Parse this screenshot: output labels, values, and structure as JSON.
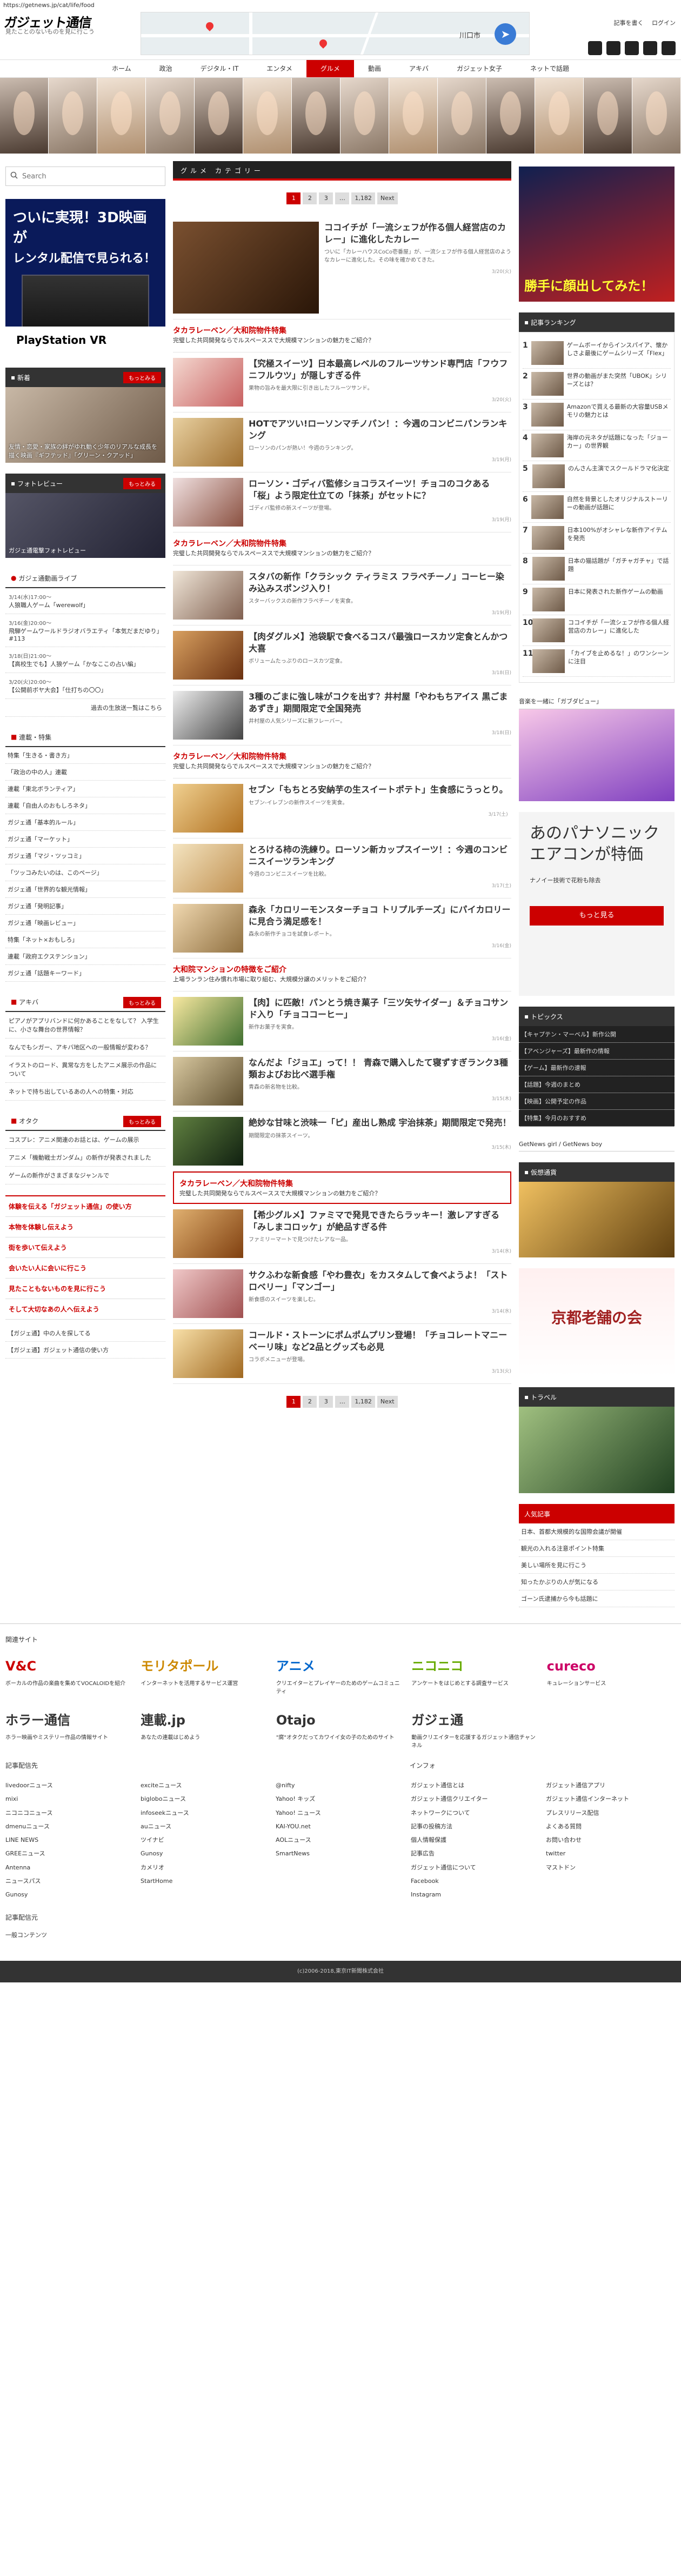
{
  "url": "https://getnews.jp/cat/life/food",
  "site": {
    "logo": "ガジェット通信",
    "tagline": "見たことのないものを見に行こう",
    "register": "記事を書く",
    "login": "ログイン",
    "city": "川口市",
    "nav_icon": "navigation-icon"
  },
  "gnav": [
    "ホーム",
    "政治",
    "デジタル・IT",
    "エンタメ",
    "グルメ",
    "動画",
    "アキバ",
    "ガジェット女子",
    "ネットで話題"
  ],
  "search": {
    "placeholder": "Search"
  },
  "left": {
    "ad": {
      "line1": "ついに実現！3D映画が",
      "line2": "レンタル配信で見られる！",
      "foot": "PlayStation VR"
    },
    "news_head": "新着",
    "more": "もっとみる",
    "news_caption": "友情・恋愛・家族の絆がゆれ動く少年のリアルな成長を描く映画『ギフテッド』「グリーン・クアッド」",
    "photo_head": "フォトレビュー",
    "photo_caption": "ガジェ通電撃フォトレビュー",
    "live_head": "ガジェ通動画ライブ",
    "live": [
      {
        "date": "3/14(水)17:00〜",
        "text": "人狼職人ゲーム「werewolf」"
      },
      {
        "date": "3/16(金)20:00〜",
        "text": "飛騨ゲームワールドラジオバラエティ「本気だまだゆり」#113"
      },
      {
        "date": "3/18(日)21:00〜",
        "text": "【高校生でも】人狼ゲーム「かなここの占い編」"
      },
      {
        "date": "3/20(火)20:00〜",
        "text": "【公開前ボヤ大会】「仕打ちの〇〇」"
      }
    ],
    "live_more": "過去の生放送一覧はこちら",
    "feature_head": "連載・特集",
    "features": [
      "特集「生きる・書き方」",
      "「政治の中の人」連載",
      "連載「東北ボランティア」",
      "連載「自由人のおもしろネタ」",
      "ガジェ通「基本的ルール」",
      "ガジェ通「マーケット」",
      "ガジェ通「マジ・ツッコミ」",
      "「ツッコみたいのは、このページ」",
      "ガジェ通「世界的な観光情報」",
      "ガジェ通「発明記事」",
      "ガジェ通「映画レビュー」",
      "特集「ネット×おもしろ」",
      "連載「政府エクステンション」",
      "ガジェ通「話題キーワード」"
    ],
    "otaku_head": "アキバ",
    "otaku": [
      "ピアノがアプリバンドに何かあることをなして？ 入学生に、小さな舞台の世界情報？",
      "なんでもシガー、アキバ地区への一般情報が変わる？",
      "イラストのロード、異常な方をしたアニメ展示の作品について",
      "ネットで持ち出しているあの人への特集・対応"
    ],
    "otaku2_head": "オタク",
    "otaku2": [
      "コスプレ：アニメ関連のお話とは、ゲームの展示",
      "アニメ「機動戦士ガンダム」の新作が発表されました",
      "ゲームの新作がさまざまなジャンルで"
    ],
    "plist": [
      "体験を伝える「ガジェット通信」の使い方",
      "本物を体験し伝えよう",
      "街を歩いて伝えよう",
      "会いたい人に会いに行こう",
      "見たこともないものを見に行こう",
      "そして大切なあの人へ伝えよう"
    ],
    "small": [
      "【ガジェ通】中の人を探してる",
      "【ガジェ通】ガジェット通信の使い方"
    ]
  },
  "center": {
    "title": "グルメ カテゴリー",
    "pager": [
      "1",
      "2",
      "3",
      "…",
      "1,182",
      "Next"
    ],
    "articles": [
      {
        "title": "ココイチが「一流シェフが作る個人経営店のカレー」に進化したカレー",
        "desc": "ついに「カレーハウスCoCo壱番屋」が、一流シェフが作る個人経営店のようなカレーに進化した。その味を確かめてきた。",
        "meta": "3/20(火)"
      },
      {
        "title": "【究極スイーツ】日本最高レベルのフルーツサンド専門店「フウフニフルウツ」が隠しすぎる件",
        "desc": "果物の旨みを最大限に引き出したフルーツサンド。",
        "meta": "3/20(火)"
      },
      {
        "title": "HOTでアツい!ローソンマチノパン！：今週のコンビニパンランキング",
        "desc": "ローソンのパンが熱い！今週のランキング。",
        "meta": "3/19(月)"
      },
      {
        "title": "ローソン・ゴディバ監修ショコラスイーツ！チョコのコクある「桜」よう限定仕立ての「抹茶」がセットに？",
        "desc": "ゴディバ監修の新スイーツが登場。",
        "meta": "3/19(月)"
      },
      {
        "title": "スタバの新作「クラシック ティラミス フラペチーノ」コーヒー染み込みスポンジ入り！",
        "desc": "スターバックスの新作フラペチーノを実食。",
        "meta": "3/19(月)"
      },
      {
        "title": "【肉ダグルメ】池袋駅で食べるコスパ最強ロースカツ定食とんかつ大喜",
        "desc": "ボリュームたっぷりのロースカツ定食。",
        "meta": "3/18(日)"
      },
      {
        "title": "3種のごまに強し味がコクを出す？井村屋「やわもちアイス 黒ごまあずき」期間限定で全国発売",
        "desc": "井村屋の人気シリーズに新フレーバー。",
        "meta": "3/18(日)"
      },
      {
        "title": "セブン「もちとろ安納芋の生スイートポテト」生食感にうっとり。",
        "desc": "セブン-イレブンの新作スイーツを実食。",
        "meta": "3/17(土)"
      },
      {
        "title": "とろける柿の洗練り。ローソン新カップスイーツ！：今週のコンビニスイーツランキング",
        "desc": "今週のコンビニスイーツを比較。",
        "meta": "3/17(土)"
      },
      {
        "title": "森永「カロリーモンスターチョコ トリプルチーズ」にパイカロリーに見合う満足感を！",
        "desc": "森永の新作チョコを試食レポート。",
        "meta": "3/16(金)"
      },
      {
        "title": "【肉】に匹敵！パンとう焼き菓子「三ツ矢サイダー」＆チョコサンド入り「チョココーヒー」",
        "desc": "新作お菓子を実食。",
        "meta": "3/16(金)"
      },
      {
        "title": "なんだよ「ジョエ」って！！ 青森で購入したて寝ずすぎランク3種類およびお比べ選手権",
        "desc": "青森の新名物を比較。",
        "meta": "3/15(木)"
      },
      {
        "title": "絶妙な甘味と渋味一「ピ」産出し熟成 宇治抹茶」期間限定で発売！",
        "desc": "期間限定の抹茶スイーツ。",
        "meta": "3/15(木)"
      },
      {
        "title": "【希少グルメ】ファミマで発見できたらラッキー！激レアすぎる「みしまコロッケ」が絶品すぎる件",
        "desc": "ファミリーマートで見つけたレアな一品。",
        "meta": "3/14(水)"
      },
      {
        "title": "サクふわな新食感「やわ豊衣」をカスタムして食べようよ！「ストロベリー」「マンゴー」",
        "desc": "新食感のスイーツを楽しむ。",
        "meta": "3/14(水)"
      },
      {
        "title": "コールド・ストーンにポムポムプリン登場！「チョコレートマニーベーリ味」など2品とグッズも必見",
        "desc": "コラボメニューが登場。",
        "meta": "3/13(火)"
      }
    ],
    "pr": {
      "title": "タカラレーベン／大和院物件特集",
      "text": "完璧した共同開発ならでルスペーススで大規模マンションの魅力をご紹介？",
      "meta": "Sponsored"
    },
    "pr2": {
      "title": "大和院マンションの特徴をご紹介",
      "text": "上場ランラン住み慣れ市場に取り組む、大規模分譲のメリットをご紹介？"
    }
  },
  "right": {
    "ad": {
      "text": "勝手に顔出してみた！"
    },
    "rank_head": "記事ランキング",
    "rank": [
      "ゲームボーイからインスパイア、懐かしさよ最後にゲームシリーズ「Flex」",
      "世界の動画がまた突然「UBOK」シリーズとは？",
      "Amazonで買える最新の大容量USBメモリの魅力とは",
      "海岸の元ネタが話題になった「ジョーカー」の世界観",
      "のんさん主演でスクールドラマ化決定",
      "自然を背景としたオリジナルストーリーの動画が話題に",
      "日本100%がオシャレな新作アイテムを発売",
      "日本の猫話題が「ガチャガチャ」で話題",
      "日本に発表された新作ゲームの動画",
      "ココイチが「一流シェフが作る個人経営店のカレー」に進化した",
      "「カイブを止めるな！」のワンシーンに注目"
    ],
    "ad2_head": "音楽を一緒に「ガブダビュー」",
    "ad3": {
      "title": "あのパナソニックエアコンが特価",
      "sub": "ナノイー技術で花粉も除去",
      "button": "もっと見る"
    },
    "topics_head": "トピックス",
    "topics": [
      "【キャプテン・マーベル】新作公開",
      "【アベンジャーズ】最新作の情報",
      "【ゲーム】最新作の速報",
      "【話題】今週のまとめ",
      "【映画】公開予定の作品",
      "【特集】今月のおすすめ"
    ],
    "girl_head": "GetNews girl / GetNews boy",
    "money_head": "仮想通貨",
    "kyoto": "京都老舗の会",
    "travel_head": "トラベル",
    "topics2_head": "人気記事",
    "topics2": [
      "日本、首都大規模的な国際会議が開催",
      "観光の入れる注意ポイント特集",
      "美しい場所を見に行こう",
      "知ったかぶりの人が気になる",
      "ゴーン氏逮捕から今も話題に"
    ]
  },
  "footer": {
    "related": "関連サイト",
    "services": [
      {
        "logo": "V&C",
        "text": "ボーカルの作品の楽曲を集めてVOCALOIDを紹介"
      },
      {
        "logo": "モリタポール",
        "text": "インターネットを活用するサービス運営"
      },
      {
        "logo": "アニメ",
        "text": "クリエイターとプレイヤーのためのゲームコミュニティ"
      },
      {
        "logo": "ニコニコ",
        "text": "アンケートをはじめとする調査サービス"
      },
      {
        "logo": "cureco",
        "text": "キュレーションサービス"
      }
    ],
    "services2": [
      {
        "logo": "ホラー通信",
        "text": "ホラー映画やミステリー作品の情報サイト"
      },
      {
        "logo": "連載.jp",
        "text": "あなたの連載はじめよう"
      },
      {
        "logo": "Otajo",
        "text": "\"腐\"オタクだってカワイイ女の子のためのサイト"
      },
      {
        "logo": "ガジェ通",
        "text": "動画クリエイターを応援するガジェット通信チャンネル"
      }
    ],
    "partner_head": "記事配信先",
    "partner": [
      [
        "livedoorニュース",
        "mixi",
        "ニコニコニュース",
        "dmenuニュース",
        "LINE NEWS",
        "GREEニュース",
        "Antenna",
        "ニュースパス",
        "Gunosy"
      ],
      [
        "exciteニュース",
        "bigloboニュース",
        "infoseekニュース",
        "auニュース",
        "ツイナビ",
        "Gunosy",
        "カメリオ",
        "StartHome"
      ],
      [
        "@nifty",
        "Yahoo! キッズ",
        "Yahoo! ニュース",
        "KAI-YOU.net",
        "AOLニュース",
        "SmartNews"
      ],
      [
        "ガジェット通信とは",
        "ガジェット通信クリエイター",
        "ネットワークについて",
        "記事の投稿方法",
        "個人情報保護",
        "記事広告",
        "ガジェット通信について",
        "Facebook",
        "Instagram"
      ],
      [
        "ガジェット通信アプリ",
        "ガジェット通信インターネット",
        "プレスリリース配信",
        "よくある質問",
        "お問い合わせ",
        "twitter",
        "マストドン"
      ]
    ],
    "info_head": "インフォ",
    "ad_head": "記事配信元",
    "ad_item": "一般コンテンツ",
    "copyright": "(c)2006-2018,東京IT新聞株式会社"
  }
}
